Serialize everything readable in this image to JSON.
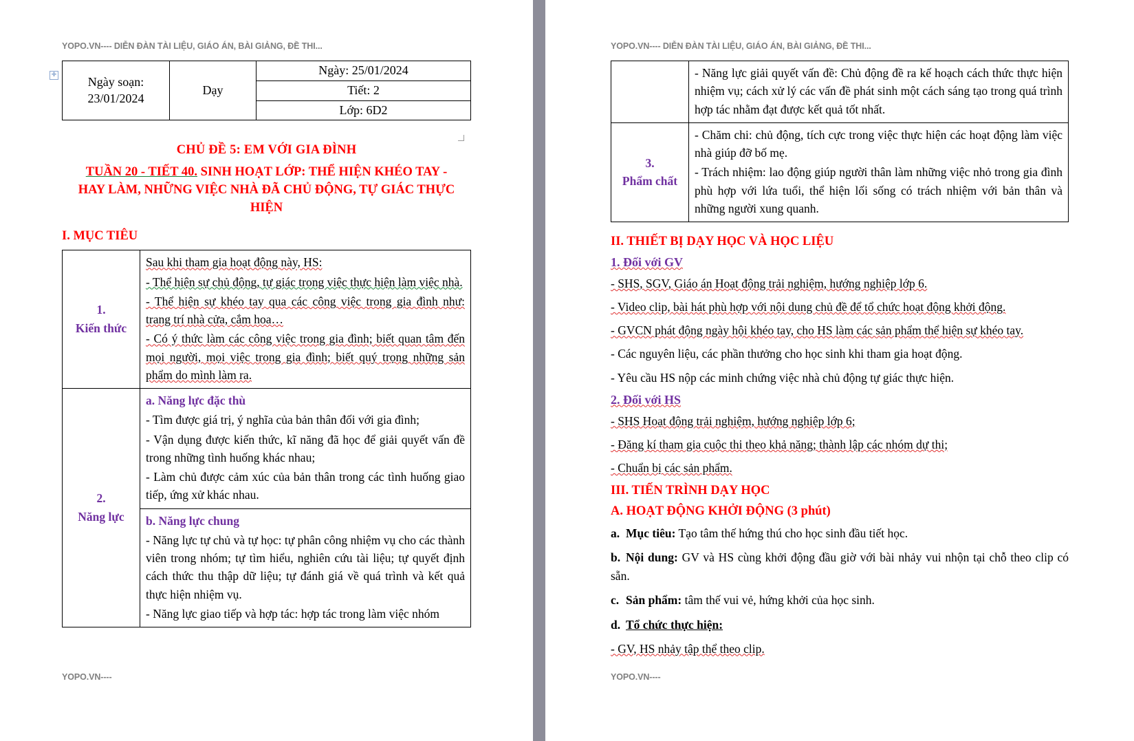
{
  "watermark": {
    "header": "YOPO.VN---- DIỄN ĐÀN TÀI LIỆU, GIÁO ÁN, BÀI GIẢNG, ĐỀ THI...",
    "footer": "YOPO.VN----"
  },
  "left_page": {
    "info_table": {
      "ngay_soan_label": "Ngày soạn:",
      "ngay_soan_value": "23/01/2024",
      "day_label": "Dạy",
      "rows": [
        "Ngày: 25/01/2024",
        "Tiết: 2",
        "Lớp: 6D2"
      ]
    },
    "title_main": "CHỦ ĐỀ 5: EM VỚI GIA ĐÌNH",
    "title_sub_week": "TUẦN 20 - TIẾT 40.",
    "title_sub_rest": " SINH HOẠT LỚP: THỂ HIỆN KHÉO TAY -",
    "title_sub_line2": "HAY LÀM, NHỮNG VIỆC NHÀ ĐÃ CHỦ ĐỘNG, TỰ GIÁC THỰC HIỆN",
    "section_i": "I. MỤC TIÊU",
    "rows": [
      {
        "num": "1.",
        "label": "Kiến thức",
        "paragraphs": [
          "Sau khi tham gia hoạt động này, HS:",
          "- Thể hiện sự  chủ động, tự giác trong việc thực hiện làm việc nhà.",
          "- Thể hiện sự khéo tay qua các công việc trong gia đình như: trang trí nhà cửa, cắm hoa…",
          "- Có ý thức làm các công việc trong gia đình; biết quan tâm đến mọi người, mọi việc trong gia đình; biết quý trọng những sản phẩm do mình làm ra."
        ]
      },
      {
        "num": "2.",
        "label": "Năng lực",
        "sub_a_heading": "a. Năng lực đặc thù",
        "sub_a_items": [
          " - Tìm được giá trị, ý nghĩa của bản thân đối với gia đình;",
          "- Vận dụng được kiến thức, kĩ năng đã học để giải quyết vấn đề trong những tình huống khác nhau;",
          "- Làm chủ được cảm xúc của bản thân trong các tình huống giao tiếp, ứng xử khác nhau."
        ],
        "sub_b_heading": "b. Năng lực chung",
        "sub_b_items": [
          "- Năng lực tự chủ và tự học: tự phân công nhiệm vụ cho các thành viên trong nhóm;  tự tìm hiểu, nghiên cứu tài liệu; tự quyết định cách thức thu thập dữ liệu; tự đánh giá về quá trình và kết quả thực hiện nhiệm vụ.",
          "- Năng lực giao tiếp và hợp tác: hợp tác trong làm việc nhóm"
        ]
      }
    ]
  },
  "right_page": {
    "table_continued": {
      "row1_paragraph": "- Năng lực giải quyết vấn đề: Chủ động đề ra kế hoạch cách thức thực hiện nhiệm vụ; cách xử lý các vấn đề phát sinh một cách sáng tạo trong quá trình hợp tác nhằm đạt được kết quả tốt nhất.",
      "row2_num": "3.",
      "row2_label": "Phẩm chất",
      "row2_paragraphs": [
        "- Chăm chi: chủ động, tích cực trong việc thực hiện các hoạt động làm việc nhà giúp đỡ bố mẹ.",
        "- Trách nhiệm: lao động giúp người thân làm những việc nhỏ trong gia đình phù hợp với lứa tuổi,  thể hiện lối sống có trách nhiệm với bản thân và những người xung quanh."
      ]
    },
    "section_ii": "II. THIẾT BỊ DẠY HỌC VÀ HỌC LIỆU",
    "sub_1_gv": "1. Đối với GV",
    "gv_items": [
      "-  SHS, SGV, Giáo án Hoạt động trải nghiệm, hướng nghiệp lớp 6.",
      "-  Video clip, bài hát phù hợp với nội dung chủ đề để tổ chức hoạt động khởi động.",
      "- GVCN phát động ngày hội khéo tay, cho HS làm các sản phẩm thể hiện sự khéo tay.",
      "- Các nguyên liệu, các phần thưởng cho học sinh khi tham gia hoạt động.",
      "- Yêu cầu HS nộp các minh chứng việc nhà chủ động tự giác thực hiện."
    ],
    "sub_2_hs": "2. Đối với HS",
    "hs_items": [
      "-  SHS Hoạt động trải nghiệm, hướng nghiệp lớp 6;",
      "-  Đăng kí tham gia cuộc thi theo khả năng; thành lập các nhóm dự thi;",
      "-  Chuẩn bị các sản phẩm."
    ],
    "section_iii": "III. TIẾN TRÌNH DẠY HỌC",
    "section_a": "A. HOẠT ĐỘNG KHỞI ĐỘNG (3 phút)",
    "abc_items": [
      {
        "marker": "a.",
        "lead": "Mục tiêu:",
        "text": " Tạo tâm thế hứng thú cho học sinh đầu tiết học."
      },
      {
        "marker": "b.",
        "lead": "Nội dung:",
        "text": " GV và HS cùng khởi động đầu giờ với bài nhảy vui nhộn tại chỗ theo clip có sẵn."
      },
      {
        "marker": "c.",
        "lead": "Sản phẩm:",
        "text": " tâm thế vui vẻ, hứng khởi của học sinh."
      },
      {
        "marker": "d.",
        "lead": "Tổ chức thực hiện:",
        "text": ""
      }
    ],
    "final_line": "- GV, HS nhảy tập thể theo clip."
  },
  "colors": {
    "heading_red": "#ff0000",
    "label_purple": "#7030a0",
    "watermark_gray": "#808080",
    "page_background": "#8d8d99"
  }
}
